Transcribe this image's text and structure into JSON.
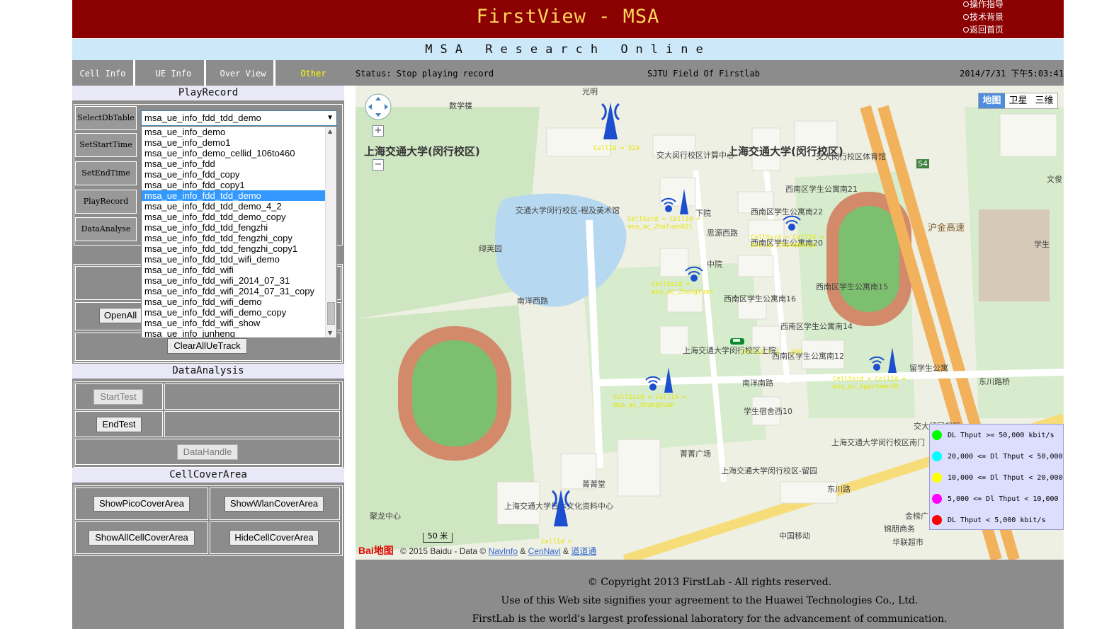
{
  "header": {
    "title": "FirstView - MSA",
    "links": [
      "操作指导",
      "技术背景",
      "返回首页"
    ],
    "subtitle": "MSA Research Online"
  },
  "nav": {
    "tabs": [
      {
        "label": "Cell Info"
      },
      {
        "label": "UE Info"
      },
      {
        "label": "Over View"
      },
      {
        "label": "Other",
        "active": true
      }
    ],
    "status": "Status: Stop playing record",
    "field": "SJTU  Field  Of  Firstlab",
    "clock": "2014/7/31 下午5:03:41"
  },
  "play_record": {
    "title": "PlayRecord",
    "rows": [
      "SelectDbTable",
      "SetStartTime",
      "SetEndTime",
      "PlayRecord",
      "DataAnalyse"
    ],
    "selected_table": "msa_ue_info_fdd_tdd_demo",
    "options": [
      "msa_ue_info_demo",
      "msa_ue_info_demo1",
      "msa_ue_info_demo_cellid_106to460",
      "msa_ue_info_fdd",
      "msa_ue_info_fdd_copy",
      "msa_ue_info_fdd_copy1",
      "msa_ue_info_fdd_tdd_demo",
      "msa_ue_info_fdd_tdd_demo_4_2",
      "msa_ue_info_fdd_tdd_demo_copy",
      "msa_ue_info_fdd_tdd_fengzhi",
      "msa_ue_info_fdd_tdd_fengzhi_copy",
      "msa_ue_info_fdd_tdd_fengzhi_copy1",
      "msa_ue_info_fdd_tdd_wifi_demo",
      "msa_ue_info_fdd_wifi",
      "msa_ue_info_fdd_wifi_2014_07_31",
      "msa_ue_info_fdd_wifi_2014_07_31_copy",
      "msa_ue_info_fdd_wifi_demo",
      "msa_ue_info_fdd_wifi_demo_copy",
      "msa_ue_info_fdd_wifi_show",
      "msa_ue_info_junheng"
    ],
    "selected_index": 6
  },
  "ue_track": {
    "open_label": "OpenAll",
    "clear_label": "ClearAllUeTrack"
  },
  "data_analysis": {
    "title": "DataAnalysis",
    "start_label": "StartTest",
    "end_label": "EndTest",
    "handle_label": "DataHandle"
  },
  "cell_cover": {
    "title": "CellCoverArea",
    "pico_label": "ShowPicoCoverArea",
    "wlan_label": "ShowWlanCoverArea",
    "all_label": "ShowAllCellCoverArea",
    "hide_label": "HideCellCoverArea"
  },
  "map": {
    "type_buttons": [
      "地图",
      "卫星",
      "三维"
    ],
    "active_type": "地图",
    "places": [
      "上海交通大学(闵行校区)",
      "上海交通大学(闵行校区)",
      "数学楼",
      "交大闵行校区计算中心",
      "交通大学闵行校区-程及美术馆",
      "绿荚园",
      "下院",
      "中院",
      "思源西路",
      "西南区学生公寓南21",
      "西南区学生公寓南22",
      "西南区学生公寓南20",
      "西南区学生公寓南16",
      "西南区学生公寓南15",
      "西南区学生公寓南14",
      "西南区学生公寓南12",
      "上海交通大学闵行校区上院",
      "南洋南路",
      "学生宿舍西10",
      "留学生公寓",
      "东川路桥",
      "交大留园餐厅",
      "菁菁广场",
      "菁菁堂",
      "上海交通大学闵行校区南门",
      "上海交通大学闵行校区-留园",
      "东川路",
      "上海交通大学日本文化资料中心",
      "中国移动",
      "金榜广",
      "锦朋商务",
      "华联超市",
      "交大闵行校区体育馆",
      "沪金高速",
      "S4",
      "南洋西路",
      "学生",
      "文俊",
      "光明",
      "聚龙中心"
    ],
    "cell_labels": [
      "CellId = 524",
      "CellSsrd =   CellId = msa_ac_ZhaTuan821",
      "CellSsrd =   CellId = msa_ac_ZhangWanyu",
      "CellSsid = msa_ac_ZhongYuan",
      "CellId = 1 - 260",
      "CellSsid =   CellId = msa_ac_ShangYuan",
      "CellSsid =   CellId = msa_ac_ApartmentB",
      "CellId ="
    ],
    "scale_label": "50 米",
    "copyright": "© 2015 Baidu - Data ©",
    "copyright_links": [
      "NavInfo",
      "CenNavi",
      "道道通"
    ],
    "logo_text": "Bai地图"
  },
  "legend": [
    {
      "label": "DL Thput >= 50,000 kbit/s",
      "color": "#00ff00"
    },
    {
      "label": "20,000 <= Dl Thput < 50,000",
      "color": "#00ffff"
    },
    {
      "label": "10,000 <= Dl Thput < 20,000",
      "color": "#ffff00"
    },
    {
      "label": "5,000 <= Dl Thput < 10,000",
      "color": "#ff00ff"
    },
    {
      "label": "DL Thput < 5,000 kbit/s",
      "color": "#ff0000"
    }
  ],
  "footer": {
    "line1": "© Copyright 2013 FirstLab - All rights reserved.",
    "line2": "Use of this Web site signifies your agreement to the Huawei Technologies Co., Ltd.",
    "line3": "FirstLab is the world's largest professional laboratory for the advancement of communication."
  }
}
